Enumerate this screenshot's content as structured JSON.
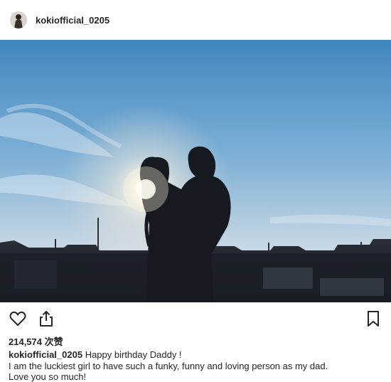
{
  "post": {
    "username": "kokiofficial_0205",
    "likes_count": "214,574",
    "likes_suffix": "次赞",
    "caption_user": "kokiofficial_0205",
    "caption_line1": "Happy birthday Daddy !",
    "caption_line2": "I am the luckiest girl to have such a funky, funny and loving person as my dad.",
    "caption_line3": "Love you so much!"
  },
  "icons": {
    "avatar": "avatar",
    "like": "heart-icon",
    "share": "share-icon",
    "save": "bookmark-icon"
  },
  "colors": {
    "text": "#262626",
    "sky_top": "#3f86bf",
    "sky_bottom": "#c9d8e4",
    "silhouette": "#161a20"
  }
}
